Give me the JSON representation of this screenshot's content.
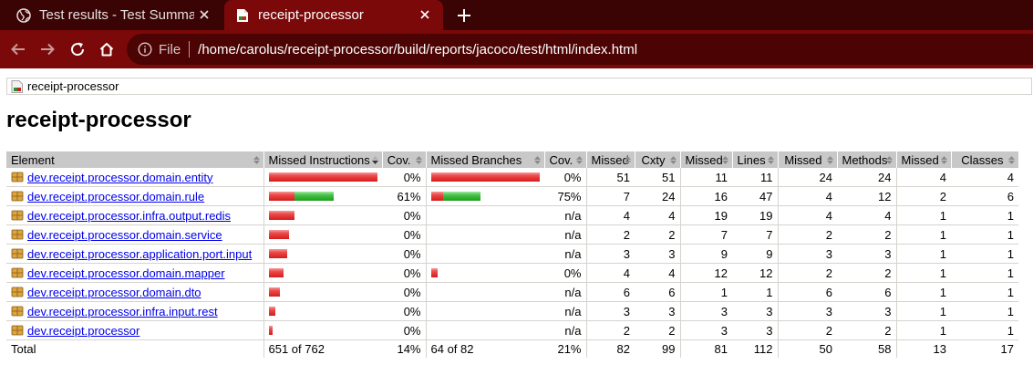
{
  "browser": {
    "tabs": [
      {
        "title": "Test results - Test Summary",
        "active": false,
        "icon": "globe-icon"
      },
      {
        "title": "receipt-processor",
        "active": true,
        "icon": "coverage-report-icon"
      }
    ],
    "omnibox": {
      "scheme_label": "File",
      "url": "/home/carolus/receipt-processor/build/reports/jacoco/test/html/index.html"
    },
    "colors": {
      "tabstrip": "#3a0404",
      "toolbar": "#7b0909",
      "omnibox": "#4c0303"
    }
  },
  "page": {
    "breadcrumb": "receipt-processor",
    "title": "receipt-processor"
  },
  "table": {
    "headers": [
      "Element",
      "Missed Instructions",
      "Cov.",
      "Missed Branches",
      "Cov.",
      "Missed",
      "Cxty",
      "Missed",
      "Lines",
      "Missed",
      "Methods",
      "Missed",
      "Classes"
    ],
    "rows": [
      {
        "name": "dev.receipt.processor.domain.entity",
        "instr_missed": 1.0,
        "instr_covered": 0.0,
        "instr_cov": "0%",
        "br_missed": 1.0,
        "br_covered": 0.0,
        "br_cov": "0%",
        "cx_missed": "51",
        "cxty": "51",
        "lines_missed": "11",
        "lines": "11",
        "meth_missed": "24",
        "methods": "24",
        "cls_missed": "4",
        "classes": "4"
      },
      {
        "name": "dev.receipt.processor.domain.rule",
        "instr_missed": 0.23,
        "instr_covered": 0.36,
        "instr_cov": "61%",
        "br_missed": 0.11,
        "br_covered": 0.34,
        "br_cov": "75%",
        "cx_missed": "7",
        "cxty": "24",
        "lines_missed": "16",
        "lines": "47",
        "meth_missed": "4",
        "methods": "12",
        "cls_missed": "2",
        "classes": "6"
      },
      {
        "name": "dev.receipt.processor.infra.output.redis",
        "instr_missed": 0.23,
        "instr_covered": 0.0,
        "instr_cov": "0%",
        "br_missed": 0.0,
        "br_covered": 0.0,
        "br_cov": "n/a",
        "cx_missed": "4",
        "cxty": "4",
        "lines_missed": "19",
        "lines": "19",
        "meth_missed": "4",
        "methods": "4",
        "cls_missed": "1",
        "classes": "1"
      },
      {
        "name": "dev.receipt.processor.domain.service",
        "instr_missed": 0.18,
        "instr_covered": 0.0,
        "instr_cov": "0%",
        "br_missed": 0.0,
        "br_covered": 0.0,
        "br_cov": "n/a",
        "cx_missed": "2",
        "cxty": "2",
        "lines_missed": "7",
        "lines": "7",
        "meth_missed": "2",
        "methods": "2",
        "cls_missed": "1",
        "classes": "1"
      },
      {
        "name": "dev.receipt.processor.application.port.input",
        "instr_missed": 0.17,
        "instr_covered": 0.0,
        "instr_cov": "0%",
        "br_missed": 0.0,
        "br_covered": 0.0,
        "br_cov": "n/a",
        "cx_missed": "3",
        "cxty": "3",
        "lines_missed": "9",
        "lines": "9",
        "meth_missed": "3",
        "methods": "3",
        "cls_missed": "1",
        "classes": "1"
      },
      {
        "name": "dev.receipt.processor.domain.mapper",
        "instr_missed": 0.13,
        "instr_covered": 0.0,
        "instr_cov": "0%",
        "br_missed": 0.06,
        "br_covered": 0.0,
        "br_cov": "0%",
        "cx_missed": "4",
        "cxty": "4",
        "lines_missed": "12",
        "lines": "12",
        "meth_missed": "2",
        "methods": "2",
        "cls_missed": "1",
        "classes": "1"
      },
      {
        "name": "dev.receipt.processor.domain.dto",
        "instr_missed": 0.1,
        "instr_covered": 0.0,
        "instr_cov": "0%",
        "br_missed": 0.0,
        "br_covered": 0.0,
        "br_cov": "n/a",
        "cx_missed": "6",
        "cxty": "6",
        "lines_missed": "1",
        "lines": "1",
        "meth_missed": "6",
        "methods": "6",
        "cls_missed": "1",
        "classes": "1"
      },
      {
        "name": "dev.receipt.processor.infra.input.rest",
        "instr_missed": 0.06,
        "instr_covered": 0.0,
        "instr_cov": "0%",
        "br_missed": 0.0,
        "br_covered": 0.0,
        "br_cov": "n/a",
        "cx_missed": "3",
        "cxty": "3",
        "lines_missed": "3",
        "lines": "3",
        "meth_missed": "3",
        "methods": "3",
        "cls_missed": "1",
        "classes": "1"
      },
      {
        "name": "dev.receipt.processor",
        "instr_missed": 0.03,
        "instr_covered": 0.0,
        "instr_cov": "0%",
        "br_missed": 0.0,
        "br_covered": 0.0,
        "br_cov": "n/a",
        "cx_missed": "2",
        "cxty": "2",
        "lines_missed": "3",
        "lines": "3",
        "meth_missed": "2",
        "methods": "2",
        "cls_missed": "1",
        "classes": "1"
      }
    ],
    "total": {
      "label": "Total",
      "instr": "651 of 762",
      "instr_cov": "14%",
      "br": "64 of 82",
      "br_cov": "21%",
      "cx_missed": "82",
      "cxty": "99",
      "lines_missed": "81",
      "lines": "112",
      "meth_missed": "50",
      "methods": "58",
      "cls_missed": "13",
      "classes": "17"
    },
    "colors": {
      "missed_bar": "#e02323",
      "covered_bar": "#3ab03a",
      "header_bg": "#c8c8c8",
      "link": "#0000ee"
    }
  }
}
